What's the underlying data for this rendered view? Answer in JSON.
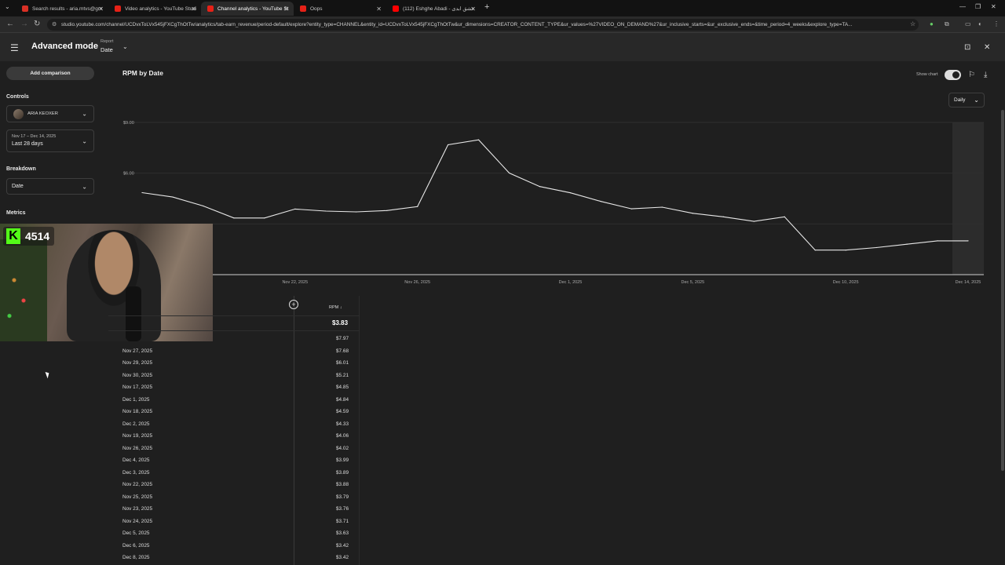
{
  "browser": {
    "tabs": [
      {
        "label": "Search results - aria.mtvs@gm",
        "icon": "gmail-icon",
        "color": "#d93025"
      },
      {
        "label": "Video analytics - YouTube Studi",
        "icon": "youtube-studio-icon",
        "color": "#e62117"
      },
      {
        "label": "Channel analytics - YouTube St",
        "icon": "youtube-studio-icon",
        "color": "#e62117"
      },
      {
        "label": "Oops",
        "icon": "youtube-studio-icon",
        "color": "#e62117"
      },
      {
        "label": "(112) Eshghe Abadi - عشق ابدی",
        "icon": "youtube-icon",
        "color": "#ff0000"
      }
    ],
    "url": "studio.youtube.com/channel/UCDvxToLVx545jFXCgThOtTw/analytics/tab-earn_revenue/period-default/explore?entity_type=CHANNEL&entity_id=UCDvxToLVx545jFXCgThOtTw&ur_dimensions=CREATOR_CONTENT_TYPE&ur_values=%27VIDEO_ON_DEMAND%27&ur_inclusive_starts=&ur_exclusive_ends=&time_period=4_weeks&explore_type=TA..."
  },
  "header": {
    "title": "Advanced mode",
    "report_label": "Report",
    "report_value": "Date"
  },
  "sidebar": {
    "add_comparison": "Add comparison",
    "controls_label": "Controls",
    "channel_name": "ARIA KEOXER",
    "date_range_small": "Nov 17 – Dec 14, 2025",
    "date_range": "Last 28 days",
    "breakdown_label": "Breakdown",
    "breakdown_value": "Date",
    "metrics_label": "Metrics"
  },
  "overlay": {
    "kick_letter": "K",
    "viewer_count": "4514"
  },
  "chart_panel": {
    "title": "RPM by Date",
    "show_chart_label": "Show chart",
    "granularity": "Daily"
  },
  "chart_data": {
    "type": "line",
    "title": "RPM by Date",
    "y_tick_labels": [
      "$9.00",
      "$6.00"
    ],
    "y_ticks": [
      9,
      6
    ],
    "ylim": [
      0,
      9
    ],
    "x_tick_labels": [
      "Nov 22, 2025",
      "Nov 26, 2025",
      "Dec 1, 2025",
      "Dec 5, 2025",
      "Dec 10, 2025",
      "Dec 14, 2025"
    ],
    "x_tick_days": [
      5,
      9,
      14,
      18,
      23,
      27
    ],
    "x": [
      "Nov 17, 2025",
      "Nov 18, 2025",
      "Nov 19, 2025",
      "Nov 20, 2025",
      "Nov 21, 2025",
      "Nov 22, 2025",
      "Nov 23, 2025",
      "Nov 24, 2025",
      "Nov 25, 2025",
      "Nov 26, 2025",
      "Nov 27, 2025",
      "Nov 28, 2025",
      "Nov 29, 2025",
      "Nov 30, 2025",
      "Dec 1, 2025",
      "Dec 2, 2025",
      "Dec 3, 2025",
      "Dec 4, 2025",
      "Dec 5, 2025",
      "Dec 6, 2025",
      "Dec 7, 2025",
      "Dec 8, 2025",
      "Dec 9, 2025",
      "Dec 10, 2025",
      "Dec 11, 2025",
      "Dec 12, 2025",
      "Dec 13, 2025",
      "Dec 14, 2025"
    ],
    "values": [
      4.85,
      4.59,
      4.06,
      3.35,
      3.35,
      3.88,
      3.76,
      3.71,
      3.79,
      4.02,
      7.68,
      7.97,
      6.01,
      5.21,
      4.84,
      4.33,
      3.89,
      3.99,
      3.63,
      3.42,
      3.15,
      3.42,
      1.45,
      1.45,
      1.6,
      1.8,
      2.0,
      2.0
    ],
    "highlight_last_day": true
  },
  "table": {
    "column_header": "RPM",
    "total": "$3.83",
    "rows": [
      {
        "date": "",
        "rpm": "$7.97"
      },
      {
        "date": "Nov 27, 2025",
        "rpm": "$7.68"
      },
      {
        "date": "Nov 29, 2025",
        "rpm": "$6.01"
      },
      {
        "date": "Nov 30, 2025",
        "rpm": "$5.21"
      },
      {
        "date": "Nov 17, 2025",
        "rpm": "$4.85"
      },
      {
        "date": "Dec 1, 2025",
        "rpm": "$4.84"
      },
      {
        "date": "Nov 18, 2025",
        "rpm": "$4.59"
      },
      {
        "date": "Dec 2, 2025",
        "rpm": "$4.33"
      },
      {
        "date": "Nov 19, 2025",
        "rpm": "$4.06"
      },
      {
        "date": "Nov 26, 2025",
        "rpm": "$4.02"
      },
      {
        "date": "Dec 4, 2025",
        "rpm": "$3.99"
      },
      {
        "date": "Dec 3, 2025",
        "rpm": "$3.89"
      },
      {
        "date": "Nov 22, 2025",
        "rpm": "$3.88"
      },
      {
        "date": "Nov 25, 2025",
        "rpm": "$3.79"
      },
      {
        "date": "Nov 23, 2025",
        "rpm": "$3.76"
      },
      {
        "date": "Nov 24, 2025",
        "rpm": "$3.71"
      },
      {
        "date": "Dec 5, 2025",
        "rpm": "$3.63"
      },
      {
        "date": "Dec 6, 2025",
        "rpm": "$3.42"
      },
      {
        "date": "Dec 8, 2025",
        "rpm": "$3.42"
      }
    ]
  }
}
